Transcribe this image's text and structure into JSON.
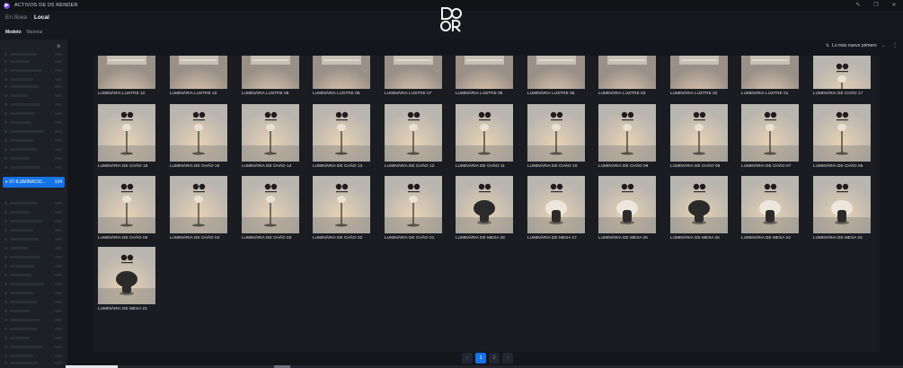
{
  "window": {
    "title": "ACTIVOS DE D5 RENDER",
    "controls": [
      "pin-icon",
      "restore-icon",
      "close-icon"
    ]
  },
  "source_tabs": [
    {
      "label": "En línea",
      "active": false
    },
    {
      "label": "Local",
      "active": true
    }
  ],
  "sub_tabs": [
    {
      "label": "Modelo",
      "active": true
    },
    {
      "label": "Material",
      "active": false
    }
  ],
  "sidebar": {
    "close_icon": "×",
    "selected_item": {
      "label": "07-ILUMINACIO...",
      "count": "134",
      "caret": "▾"
    }
  },
  "sort": {
    "label": "Lo más nuevo primero",
    "icon": "sort-icon"
  },
  "items": [
    "LUMINÁRIA LUSTRE 12",
    "LUMINÁRIA LUSTRE 10",
    "LUMINÁRIA LUSTRE 09",
    "LUMINÁRIA LUSTRE 08",
    "LUMINÁRIA LUSTRE 07",
    "LUMINÁRIA LUSTRE 06",
    "LUMINÁRIA LUSTRE 05",
    "LUMINÁRIA LUSTRE 03",
    "LUMINÁRIA LUSTRE 02",
    "LUMINÁRIA LUSTRE 01",
    "LUMINÁRIA DE CHÃO 17",
    "LUMINÁRIA DE CHÃO 16",
    "LUMINÁRIA DE CHÃO 15",
    "LUMINÁRIA DE CHÃO 14",
    "LUMINÁRIA DE CHÃO 13",
    "LUMINÁRIA DE CHÃO 12",
    "LUMINÁRIA DE CHÃO 11",
    "LUMINÁRIA DE CHÃO 10",
    "LUMINÁRIA DE CHÃO 09",
    "LUMINÁRIA DE CHÃO 08",
    "LUMINÁRIA DE CHÃO 07",
    "LUMINÁRIA DE CHÃO 06",
    "LUMINÁRIA DE CHÃO 05",
    "LUMINÁRIA DE CHÃO 04",
    "LUMINÁRIA DE CHÃO 03",
    "LUMINÁRIA DE CHÃO 02",
    "LUMINÁRIA DE CHÃO 01",
    "LUMINÁRIA DE MESA 28",
    "LUMINÁRIA DE MESA 27",
    "LUMINÁRIA DE MESA 26",
    "LUMINÁRIA DE MESA 25",
    "LUMINÁRIA DE MESA 24",
    "LUMINÁRIA DE MESA 22",
    "LUMINÁRIA DE MESA 21"
  ],
  "pagination": {
    "prev": "‹",
    "pages": [
      "1",
      "2"
    ],
    "active": "1",
    "next": "›"
  },
  "colors": {
    "accent": "#1473e6",
    "background": "#14161b",
    "panel": "#1a1c21"
  }
}
